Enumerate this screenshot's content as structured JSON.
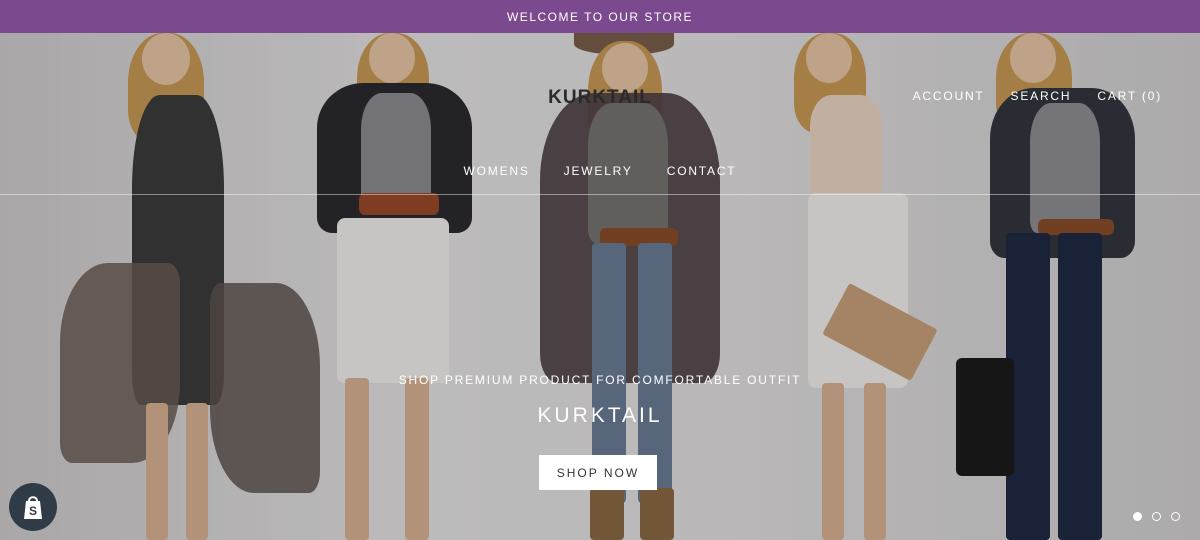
{
  "announcement": {
    "text": "WELCOME TO OUR STORE"
  },
  "header": {
    "logo": "KURKTAIL",
    "utility_nav": [
      "ACCOUNT",
      "SEARCH",
      "CART (0)"
    ],
    "main_nav": [
      "WOMENS",
      "JEWELRY",
      "CONTACT"
    ]
  },
  "hero": {
    "subtitle": "SHOP PREMIUM PRODUCT FOR COMFORTABLE OUTFIT",
    "title": "KURKTAIL",
    "cta_label": "SHOP NOW",
    "slides_total": 3,
    "active_slide": 1
  },
  "badges": {
    "shopify_icon": "shopify-bag-icon"
  },
  "colors": {
    "announcement_bg": "#7b4a8e",
    "badge_bg": "#2f3b46",
    "button_bg": "#ffffff"
  }
}
